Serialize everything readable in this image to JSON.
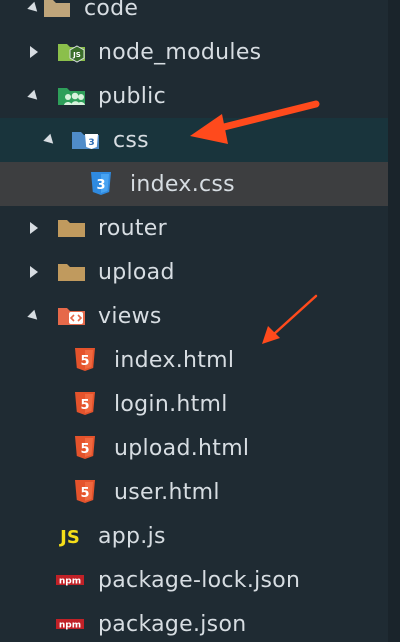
{
  "explorer": {
    "items": [
      {
        "label": "code",
        "icon": "folder-open-icon",
        "expanded": true
      },
      {
        "label": "node_modules",
        "icon": "node-folder-icon",
        "expanded": false
      },
      {
        "label": "public",
        "icon": "public-folder-icon",
        "expanded": true
      },
      {
        "label": "css",
        "icon": "css-folder-icon",
        "expanded": true,
        "selected": true
      },
      {
        "label": "index.css",
        "icon": "css3-file-icon"
      },
      {
        "label": "router",
        "icon": "folder-icon",
        "expanded": false
      },
      {
        "label": "upload",
        "icon": "folder-icon",
        "expanded": false
      },
      {
        "label": "views",
        "icon": "views-folder-icon",
        "expanded": true
      },
      {
        "label": "index.html",
        "icon": "html5-file-icon"
      },
      {
        "label": "login.html",
        "icon": "html5-file-icon"
      },
      {
        "label": "upload.html",
        "icon": "html5-file-icon"
      },
      {
        "label": "user.html",
        "icon": "html5-file-icon"
      },
      {
        "label": "app.js",
        "icon": "js-file-icon"
      },
      {
        "label": "package-lock.json",
        "icon": "npm-file-icon"
      },
      {
        "label": "package.json",
        "icon": "npm-file-icon"
      }
    ]
  },
  "icon_glyphs": {
    "js": "JS",
    "npm": "npm",
    "css_badge": "3",
    "html_badge": "5"
  },
  "colors": {
    "background": "#1f2b33",
    "selected_row": "#19343c",
    "hover_row": "#3d3e40",
    "text": "#d7dde2",
    "annotation_arrow": "#ff4a1c"
  }
}
